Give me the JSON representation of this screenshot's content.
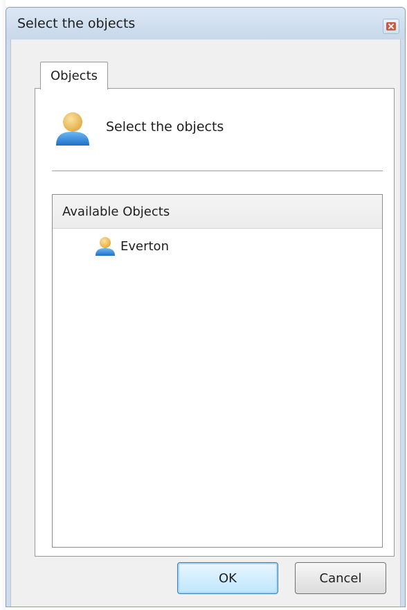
{
  "window": {
    "title": "Select the objects"
  },
  "tabs": [
    {
      "label": "Objects"
    }
  ],
  "panel": {
    "header_text": "Select the objects",
    "header_icon": "user-icon"
  },
  "list": {
    "header": "Available Objects",
    "items": [
      {
        "label": "Everton",
        "icon": "user-icon"
      }
    ]
  },
  "buttons": {
    "ok_label": "OK",
    "cancel_label": "Cancel"
  },
  "colors": {
    "frame": "#cfdcea",
    "close_button": "#c45c4a",
    "ok_border": "#3c7fb1",
    "user_head": "#f0c060",
    "user_body": "#3a8fe0"
  }
}
